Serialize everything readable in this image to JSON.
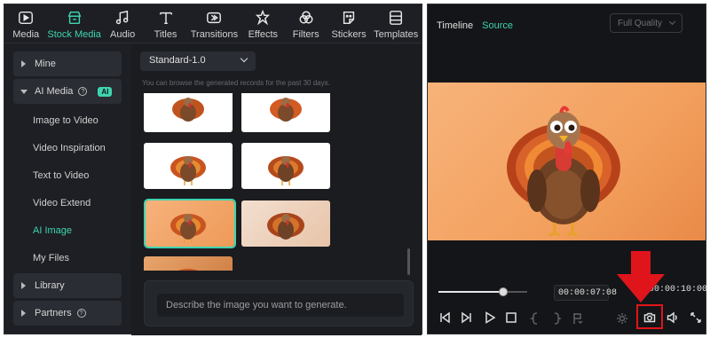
{
  "toolbar": {
    "items": [
      {
        "label": "Media",
        "icon": "media-icon"
      },
      {
        "label": "Stock Media",
        "icon": "stock-media-icon",
        "active": true
      },
      {
        "label": "Audio",
        "icon": "audio-icon"
      },
      {
        "label": "Titles",
        "icon": "titles-icon"
      },
      {
        "label": "Transitions",
        "icon": "transitions-icon"
      },
      {
        "label": "Effects",
        "icon": "effects-icon"
      },
      {
        "label": "Filters",
        "icon": "filters-icon"
      },
      {
        "label": "Stickers",
        "icon": "stickers-icon"
      },
      {
        "label": "Templates",
        "icon": "templates-icon"
      }
    ]
  },
  "sidebar": {
    "mine": "Mine",
    "ai_media": "AI Media",
    "ai_badge": "AI",
    "help_mark": "?",
    "subitems": [
      "Image to Video",
      "Video Inspiration",
      "Text to Video",
      "Video Extend",
      "AI Image",
      "My Files"
    ],
    "active_subitem": "AI Image",
    "library": "Library",
    "partners": "Partners"
  },
  "content": {
    "model_select": "Standard-1.0",
    "hint": "You can browse the generated records for the past 30 days.",
    "prompt_placeholder": "Describe the image you want to generate."
  },
  "preview_panel": {
    "tabs": [
      "Timeline",
      "Source"
    ],
    "active_tab": "Source",
    "quality": "Full Quality",
    "current_time": "00:00:07:08",
    "total_time": "00:00:10:00",
    "playhead_fraction": 0.73
  },
  "colors": {
    "accent": "#3fd4b0",
    "highlight": "#e0151b"
  }
}
